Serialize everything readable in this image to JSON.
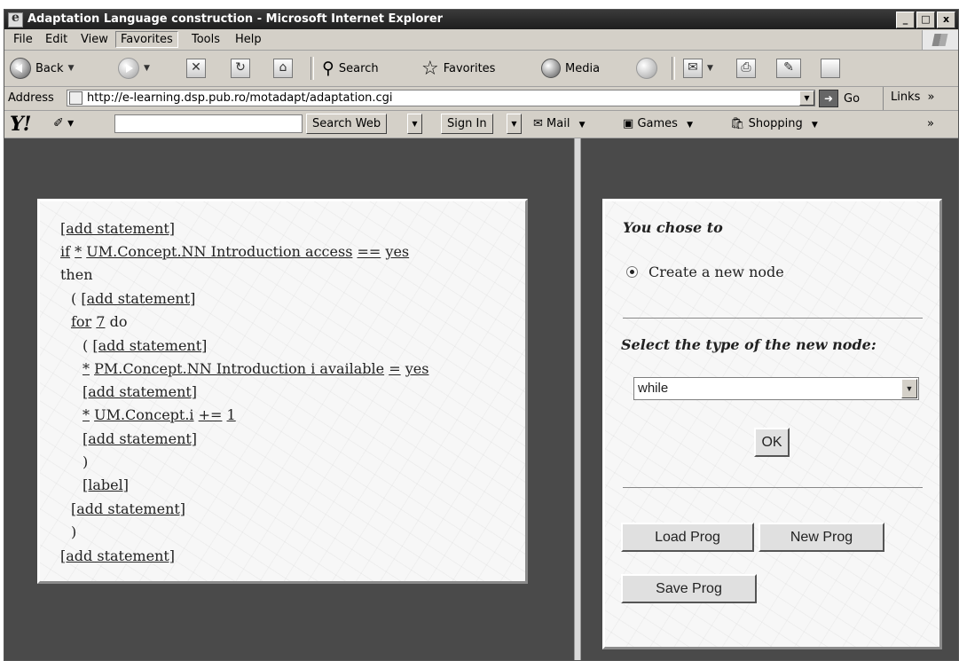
{
  "window": {
    "title": "Adaptation Language construction - Microsoft Internet Explorer",
    "controls": {
      "minimize": "_",
      "maximize": "□",
      "close": "x"
    }
  },
  "menu": {
    "items": [
      "File",
      "Edit",
      "View",
      "Favorites",
      "Tools",
      "Help"
    ],
    "active": "Favorites"
  },
  "toolbar": {
    "back": "Back",
    "search": "Search",
    "favorites": "Favorites",
    "media": "Media"
  },
  "address": {
    "label": "Address",
    "url": "http://e-learning.dsp.pub.ro/motadapt/adaptation.cgi",
    "go": "Go",
    "links": "Links",
    "links_more": "»"
  },
  "yahoo": {
    "logo": "Y!",
    "search_web": "Search Web",
    "sign_in": "Sign In",
    "mail": "Mail",
    "games": "Games",
    "shopping": "Shopping",
    "more": "»"
  },
  "program": {
    "lines": {
      "l1": {
        "add": "[add statement]"
      },
      "l2": {
        "kw_if": "if",
        "star": "*",
        "target": "UM.Concept.NN Introduction access",
        "op": "==",
        "value": "yes"
      },
      "l3": {
        "kw_then": "then"
      },
      "l4": {
        "paren": "(",
        "add": "[add statement]"
      },
      "l5": {
        "kw_for": "for",
        "count": "7",
        "kw_do": "do"
      },
      "l6": {
        "paren": "(",
        "add": "[add statement]"
      },
      "l7": {
        "star": "*",
        "target": "PM.Concept.NN Introduction i available",
        "op": "=",
        "value": "yes"
      },
      "l8": {
        "add": "[add statement]"
      },
      "l9": {
        "star": "*",
        "target": "UM.Concept.i",
        "op": "+=",
        "value": "1"
      },
      "l10": {
        "add": "[add statement]"
      },
      "l11": {
        "paren": ")"
      },
      "l12": {
        "label": "[label]"
      },
      "l13": {
        "add": "[add statement]"
      },
      "l14": {
        "paren": ")"
      },
      "l15": {
        "add": "[add statement]"
      }
    }
  },
  "side": {
    "chose_heading": "You chose to",
    "radio_label": "Create a new node",
    "select_heading": "Select the type of the new node:",
    "node_type": "while",
    "ok": "OK",
    "load": "Load Prog",
    "new": "New Prog",
    "save": "Save Prog"
  }
}
